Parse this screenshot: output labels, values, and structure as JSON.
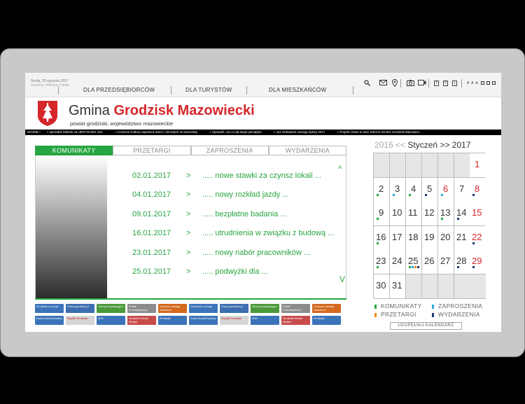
{
  "header": {
    "date_line1": "Środa, 25 stycznia 2017",
    "date_line2": "Imieniny: Miłosza, Pawła",
    "nav": [
      "DLA PRZEDSIĘBIORCÓW",
      "DLA TURYSTÓW",
      "DLA MIESZKAŃCÓW"
    ],
    "social": [
      "f",
      "Y",
      "t"
    ],
    "font_sizes": "A A A",
    "icons": [
      "search-icon",
      "mail-icon",
      "location-icon",
      "camera-icon",
      "video-icon",
      "facebook-icon",
      "youtube-icon",
      "twitter-icon"
    ]
  },
  "site": {
    "title_plain": "Gmina",
    "title_bold": "Grodzisk Mazowiecki",
    "subtitle": "powiat grodziski, województwo mazowieckie",
    "accent_red": "#d5262a",
    "accent_green": "#27a540"
  },
  "ticker": [
    "WAŻNE !",
    "sprzedaż biletów na UEFA EURO U21",
    "Centrum Kultury zaprasza dzieci i dorosłych na warsztaty",
    "Sprawdź, na co idą twoje pieniądze",
    "Już niebawem ruszają Sploty 2017",
    "Projekt zmian w sieci szkół w Gminie Grodzisk Mazowiec..."
  ],
  "tabs": [
    {
      "label": "KOMUNIKATY",
      "active": true
    },
    {
      "label": "PRZETARGI",
      "active": false
    },
    {
      "label": "ZAPROSZENIA",
      "active": false
    },
    {
      "label": "WYDARZENIA",
      "active": false
    }
  ],
  "news": [
    {
      "date": "02.01.2017",
      "sep": ">",
      "text": "..... nowe stawki za czynsz lokali ..."
    },
    {
      "date": "04.01.2017",
      "sep": ">",
      "text": "..... nowy rozkład jazdy ..."
    },
    {
      "date": "09.01.2017",
      "sep": ">",
      "text": "..... bezpłatne badania ..."
    },
    {
      "date": "16.01.2017",
      "sep": ">",
      "text": "..... utrudnienia w związku z budową ..."
    },
    {
      "date": "23.01.2017",
      "sep": ">",
      "text": "..... nowy nabór pracowników ..."
    },
    {
      "date": "25.01.2017",
      "sep": ">",
      "text": "..... podwyżki dla ..."
    }
  ],
  "news_scroll": {
    "up": "^",
    "down": "V"
  },
  "banners": [
    [
      "Grodzisk e-Urząd",
      "Praca grodzisk.pl",
      "Tereny inwestycyjne",
      "Portal Przedsiębiorcy",
      "Centrum obsługi inwestora",
      "Grodzisk e-Urząd",
      "Praca grodzisk.pl",
      "Tereny inwestycyjne",
      "Portal Przedsiębiorcy",
      "Centrum obsługi inwestora"
    ],
    [
      "Karta Dużej Rodziny",
      "Szpital Grodzisk",
      "500+",
      "Grodzisk Rower Miejski",
      "ePodatki",
      "Karta Dużej Rodziny",
      "Szpital Grodzisk",
      "500+",
      "Grodzisk Rower Miejski",
      "ePodatki"
    ]
  ],
  "calendar": {
    "prev_year": "2016",
    "prev_nav": "<<",
    "month": "Styczeń",
    "next_nav": ">>",
    "year": "2017",
    "weeks": [
      [
        null,
        null,
        null,
        null,
        null,
        null,
        "1"
      ],
      [
        "2",
        "3",
        "4",
        "5",
        "6",
        "7",
        "8"
      ],
      [
        "9",
        "10",
        "11",
        "12",
        "13",
        "14",
        "15"
      ],
      [
        "16",
        "17",
        "18",
        "19",
        "20",
        "21",
        "22"
      ],
      [
        "23",
        "24",
        "25",
        "26",
        "27",
        "28",
        "29"
      ],
      [
        "30",
        "31",
        null,
        null,
        null,
        null,
        null
      ]
    ],
    "red_days": [
      "1",
      "6",
      "8",
      "15",
      "22",
      "29"
    ],
    "events": {
      "2": [
        "green"
      ],
      "3": [
        "cyan"
      ],
      "4": [
        "green"
      ],
      "5": [
        "navy"
      ],
      "6": [
        "cyan"
      ],
      "8": [
        "navy"
      ],
      "9": [
        "green"
      ],
      "13": [
        "green"
      ],
      "14": [
        "navy"
      ],
      "16": [
        "green"
      ],
      "22": [
        "navy"
      ],
      "23": [
        "green"
      ],
      "25": [
        "green",
        "cyan",
        "orange",
        "navy"
      ],
      "28": [
        "navy"
      ],
      "29": [
        "navy"
      ]
    },
    "event_colors": {
      "green": "#27a540",
      "cyan": "#2aa9d6",
      "orange": "#f08c1a",
      "navy": "#1f3b7a"
    }
  },
  "legend": [
    {
      "label": "KOMUNIKATY",
      "color": "#27a540"
    },
    {
      "label": "ZAPROSZENIA",
      "color": "#2aa9d6"
    },
    {
      "label": "PRZETARGI",
      "color": "#f08c1a"
    },
    {
      "label": "WYDARZENIA",
      "color": "#1f3b7a"
    }
  ],
  "fill_calendar_button": "UZUPEŁNIJ KALENDARZ"
}
